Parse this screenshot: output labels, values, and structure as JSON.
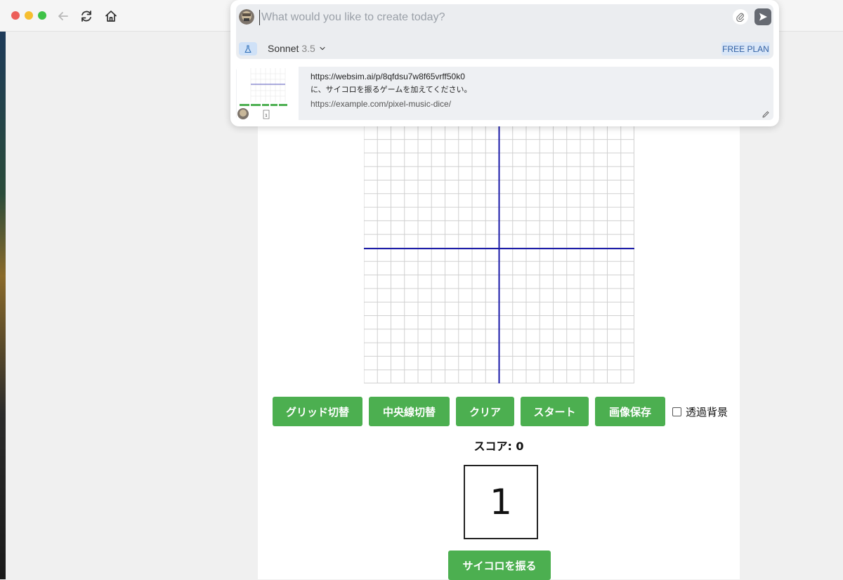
{
  "browser": {
    "icons": [
      "close-dot",
      "minimize-dot",
      "maximize-dot",
      "back-arrow-icon",
      "reload-icon",
      "home-icon"
    ]
  },
  "prompt": {
    "placeholder": "What would you like to create today?",
    "model_name": "Sonnet",
    "model_version": "3.5",
    "plan_badge": "FREE PLAN"
  },
  "history": {
    "url": "https://websim.ai/p/8qfdsu7w8f65vrff50k0",
    "prompt_text": "に、サイコロを振るゲームを加えてください。",
    "link": "https://example.com/pixel-music-dice/",
    "thumb_digit": "1"
  },
  "app": {
    "buttons": {
      "grid_toggle": "グリッド切替",
      "center_toggle": "中央線切替",
      "clear": "クリア",
      "start": "スタート",
      "save_image": "画像保存"
    },
    "transparent_bg_label": "透過背景",
    "transparent_bg_checked": false,
    "score_label": "スコア:",
    "score_value": "0",
    "dice_value": "1",
    "roll_button": "サイコロを振る",
    "colors": {
      "button_green": "#4caf50",
      "center_line_blue": "#1a1aa8",
      "grid_line": "#d0d0d0"
    }
  }
}
